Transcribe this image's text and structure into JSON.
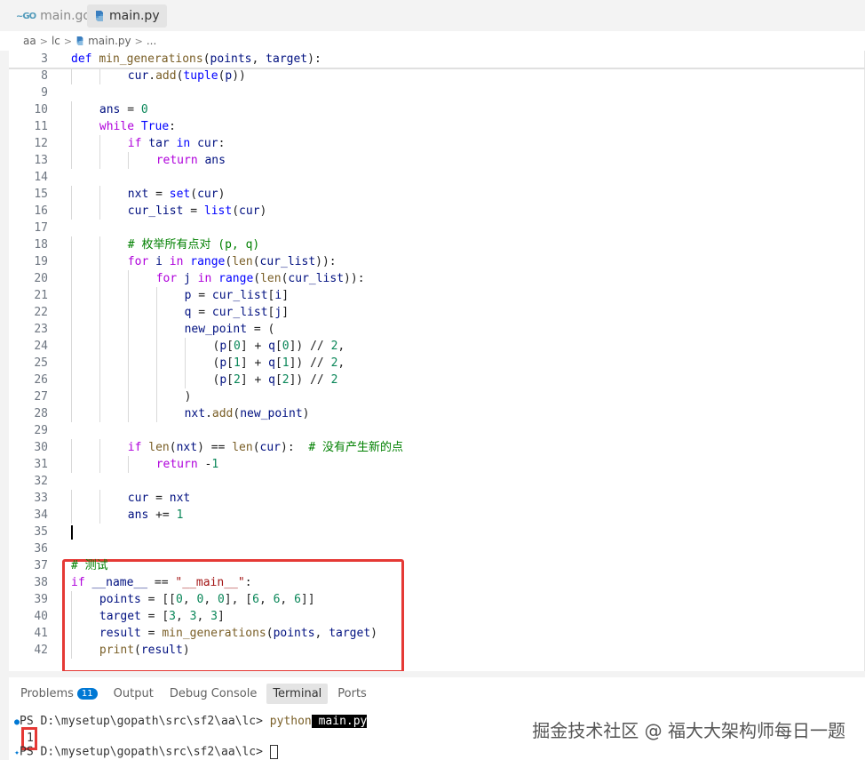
{
  "tabs": [
    {
      "label": "main.go",
      "icon": "go-icon",
      "active": false
    },
    {
      "label": "main.py",
      "icon": "python-icon",
      "active": true
    }
  ],
  "breadcrumb": [
    "aa",
    "lc",
    "main.py",
    "..."
  ],
  "code_lines": [
    {
      "n": "3",
      "indent": 0,
      "html": "<span class=\"kw\">def</span> <span class=\"fn\">min_generations</span>(<span class=\"var\">points</span>, <span class=\"var\">target</span>):"
    },
    {
      "n": "8",
      "indent": 2,
      "html": "<span class=\"var\">cur</span>.<span class=\"fn\">add</span>(<span class=\"kw\">tuple</span>(<span class=\"var\">p</span>))"
    },
    {
      "n": "9",
      "indent": 0,
      "html": ""
    },
    {
      "n": "10",
      "indent": 1,
      "html": "<span class=\"var\">ans</span> = <span class=\"num\">0</span>"
    },
    {
      "n": "11",
      "indent": 1,
      "html": "<span class=\"ctl\">while</span> <span class=\"kw\">True</span>:"
    },
    {
      "n": "12",
      "indent": 2,
      "html": "<span class=\"ctl\">if</span> <span class=\"var\">tar</span> <span class=\"kw\">in</span> <span class=\"var\">cur</span>:"
    },
    {
      "n": "13",
      "indent": 3,
      "html": "<span class=\"ctl\">return</span> <span class=\"var\">ans</span>"
    },
    {
      "n": "14",
      "indent": 0,
      "html": ""
    },
    {
      "n": "15",
      "indent": 2,
      "html": "<span class=\"var\">nxt</span> = <span class=\"kw\">set</span>(<span class=\"var\">cur</span>)"
    },
    {
      "n": "16",
      "indent": 2,
      "html": "<span class=\"var\">cur_list</span> = <span class=\"kw\">list</span>(<span class=\"var\">cur</span>)"
    },
    {
      "n": "17",
      "indent": 0,
      "html": ""
    },
    {
      "n": "18",
      "indent": 2,
      "html": "<span class=\"cmt\"># 枚举所有点对 (p, q)</span>"
    },
    {
      "n": "19",
      "indent": 2,
      "html": "<span class=\"ctl\">for</span> <span class=\"var\">i</span> <span class=\"ctl\">in</span> <span class=\"kw\">range</span>(<span class=\"fn\">len</span>(<span class=\"var\">cur_list</span>)):"
    },
    {
      "n": "20",
      "indent": 3,
      "html": "<span class=\"ctl\">for</span> <span class=\"var\">j</span> <span class=\"ctl\">in</span> <span class=\"kw\">range</span>(<span class=\"fn\">len</span>(<span class=\"var\">cur_list</span>)):"
    },
    {
      "n": "21",
      "indent": 4,
      "html": "<span class=\"var\">p</span> = <span class=\"var\">cur_list</span>[<span class=\"var\">i</span>]"
    },
    {
      "n": "22",
      "indent": 4,
      "html": "<span class=\"var\">q</span> = <span class=\"var\">cur_list</span>[<span class=\"var\">j</span>]"
    },
    {
      "n": "23",
      "indent": 4,
      "html": "<span class=\"var\">new_point</span> = ("
    },
    {
      "n": "24",
      "indent": 5,
      "html": "(<span class=\"var\">p</span>[<span class=\"num\">0</span>] + <span class=\"var\">q</span>[<span class=\"num\">0</span>]) // <span class=\"num\">2</span>,"
    },
    {
      "n": "25",
      "indent": 5,
      "html": "(<span class=\"var\">p</span>[<span class=\"num\">1</span>] + <span class=\"var\">q</span>[<span class=\"num\">1</span>]) // <span class=\"num\">2</span>,"
    },
    {
      "n": "26",
      "indent": 5,
      "html": "(<span class=\"var\">p</span>[<span class=\"num\">2</span>] + <span class=\"var\">q</span>[<span class=\"num\">2</span>]) // <span class=\"num\">2</span>"
    },
    {
      "n": "27",
      "indent": 4,
      "html": ")"
    },
    {
      "n": "28",
      "indent": 4,
      "html": "<span class=\"var\">nxt</span>.<span class=\"fn\">add</span>(<span class=\"var\">new_point</span>)"
    },
    {
      "n": "29",
      "indent": 0,
      "html": ""
    },
    {
      "n": "30",
      "indent": 2,
      "html": "<span class=\"ctl\">if</span> <span class=\"fn\">len</span>(<span class=\"var\">nxt</span>) == <span class=\"fn\">len</span>(<span class=\"var\">cur</span>):  <span class=\"cmt\"># 没有产生新的点</span>"
    },
    {
      "n": "31",
      "indent": 3,
      "html": "<span class=\"ctl\">return</span> -<span class=\"num\">1</span>"
    },
    {
      "n": "32",
      "indent": 0,
      "html": ""
    },
    {
      "n": "33",
      "indent": 2,
      "html": "<span class=\"var\">cur</span> = <span class=\"var\">nxt</span>"
    },
    {
      "n": "34",
      "indent": 2,
      "html": "<span class=\"var\">ans</span> += <span class=\"num\">1</span>"
    },
    {
      "n": "35",
      "indent": 0,
      "html": "",
      "cursor": true
    },
    {
      "n": "36",
      "indent": 0,
      "html": ""
    },
    {
      "n": "37",
      "indent": 0,
      "html": "<span class=\"cmt\"># 测试</span>"
    },
    {
      "n": "38",
      "indent": 0,
      "html": "<span class=\"ctl\">if</span> <span class=\"var\">__name__</span> == <span class=\"str\">\"__main__\"</span>:"
    },
    {
      "n": "39",
      "indent": 1,
      "html": "<span class=\"var\">points</span> = [[<span class=\"num\">0</span>, <span class=\"num\">0</span>, <span class=\"num\">0</span>], [<span class=\"num\">6</span>, <span class=\"num\">6</span>, <span class=\"num\">6</span>]]"
    },
    {
      "n": "40",
      "indent": 1,
      "html": "<span class=\"var\">target</span> = [<span class=\"num\">3</span>, <span class=\"num\">3</span>, <span class=\"num\">3</span>]"
    },
    {
      "n": "41",
      "indent": 1,
      "html": "<span class=\"var\">result</span> = <span class=\"fn\">min_generations</span>(<span class=\"var\">points</span>, <span class=\"var\">target</span>)"
    },
    {
      "n": "42",
      "indent": 1,
      "html": "<span class=\"fn\">print</span>(<span class=\"var\">result</span>)"
    }
  ],
  "panel": {
    "tabs": [
      {
        "label": "Problems",
        "badge": "11"
      },
      {
        "label": "Output"
      },
      {
        "label": "Debug Console"
      },
      {
        "label": "Terminal",
        "active": true
      },
      {
        "label": "Ports"
      }
    ],
    "terminal": {
      "prompt1": "PS D:\\mysetup\\gopath\\src\\sf2\\aa\\lc> ",
      "cmd": "python",
      "arg": " main.py",
      "output": "1",
      "prompt2": "PS D:\\mysetup\\gopath\\src\\sf2\\aa\\lc> "
    }
  },
  "watermark": "掘金技术社区 @ 福大大架构师每日一题",
  "colors": {
    "highlight": "#e53935",
    "accent": "#0078d4"
  }
}
